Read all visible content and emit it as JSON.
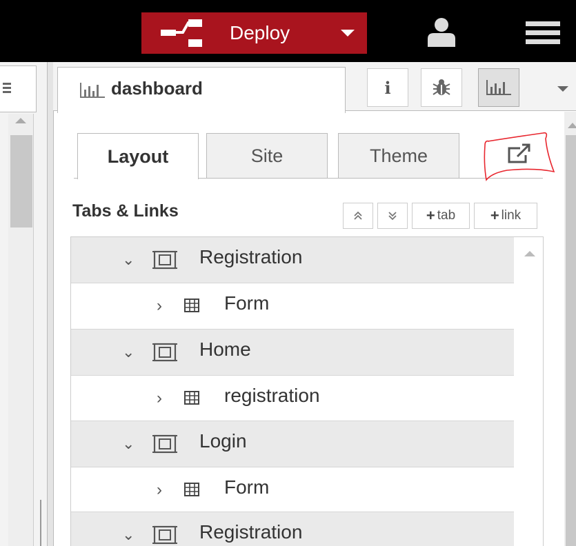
{
  "header": {
    "deploy_label": "Deploy"
  },
  "sidebar": {
    "tab_label": "dashboard"
  },
  "subtabs": [
    "Layout",
    "Site",
    "Theme"
  ],
  "tabs_links": {
    "title": "Tabs & Links",
    "add_tab_label": "tab",
    "add_link_label": "link"
  },
  "tree": [
    {
      "label": "Registration"
    },
    {
      "label": "Form"
    },
    {
      "label": "Home"
    },
    {
      "label": "registration"
    },
    {
      "label": "Login"
    },
    {
      "label": "Form"
    },
    {
      "label": "Registration"
    }
  ],
  "colors": {
    "deploy_bg": "#a9141e",
    "header_bg": "#000000",
    "annotation": "#e8262e"
  }
}
